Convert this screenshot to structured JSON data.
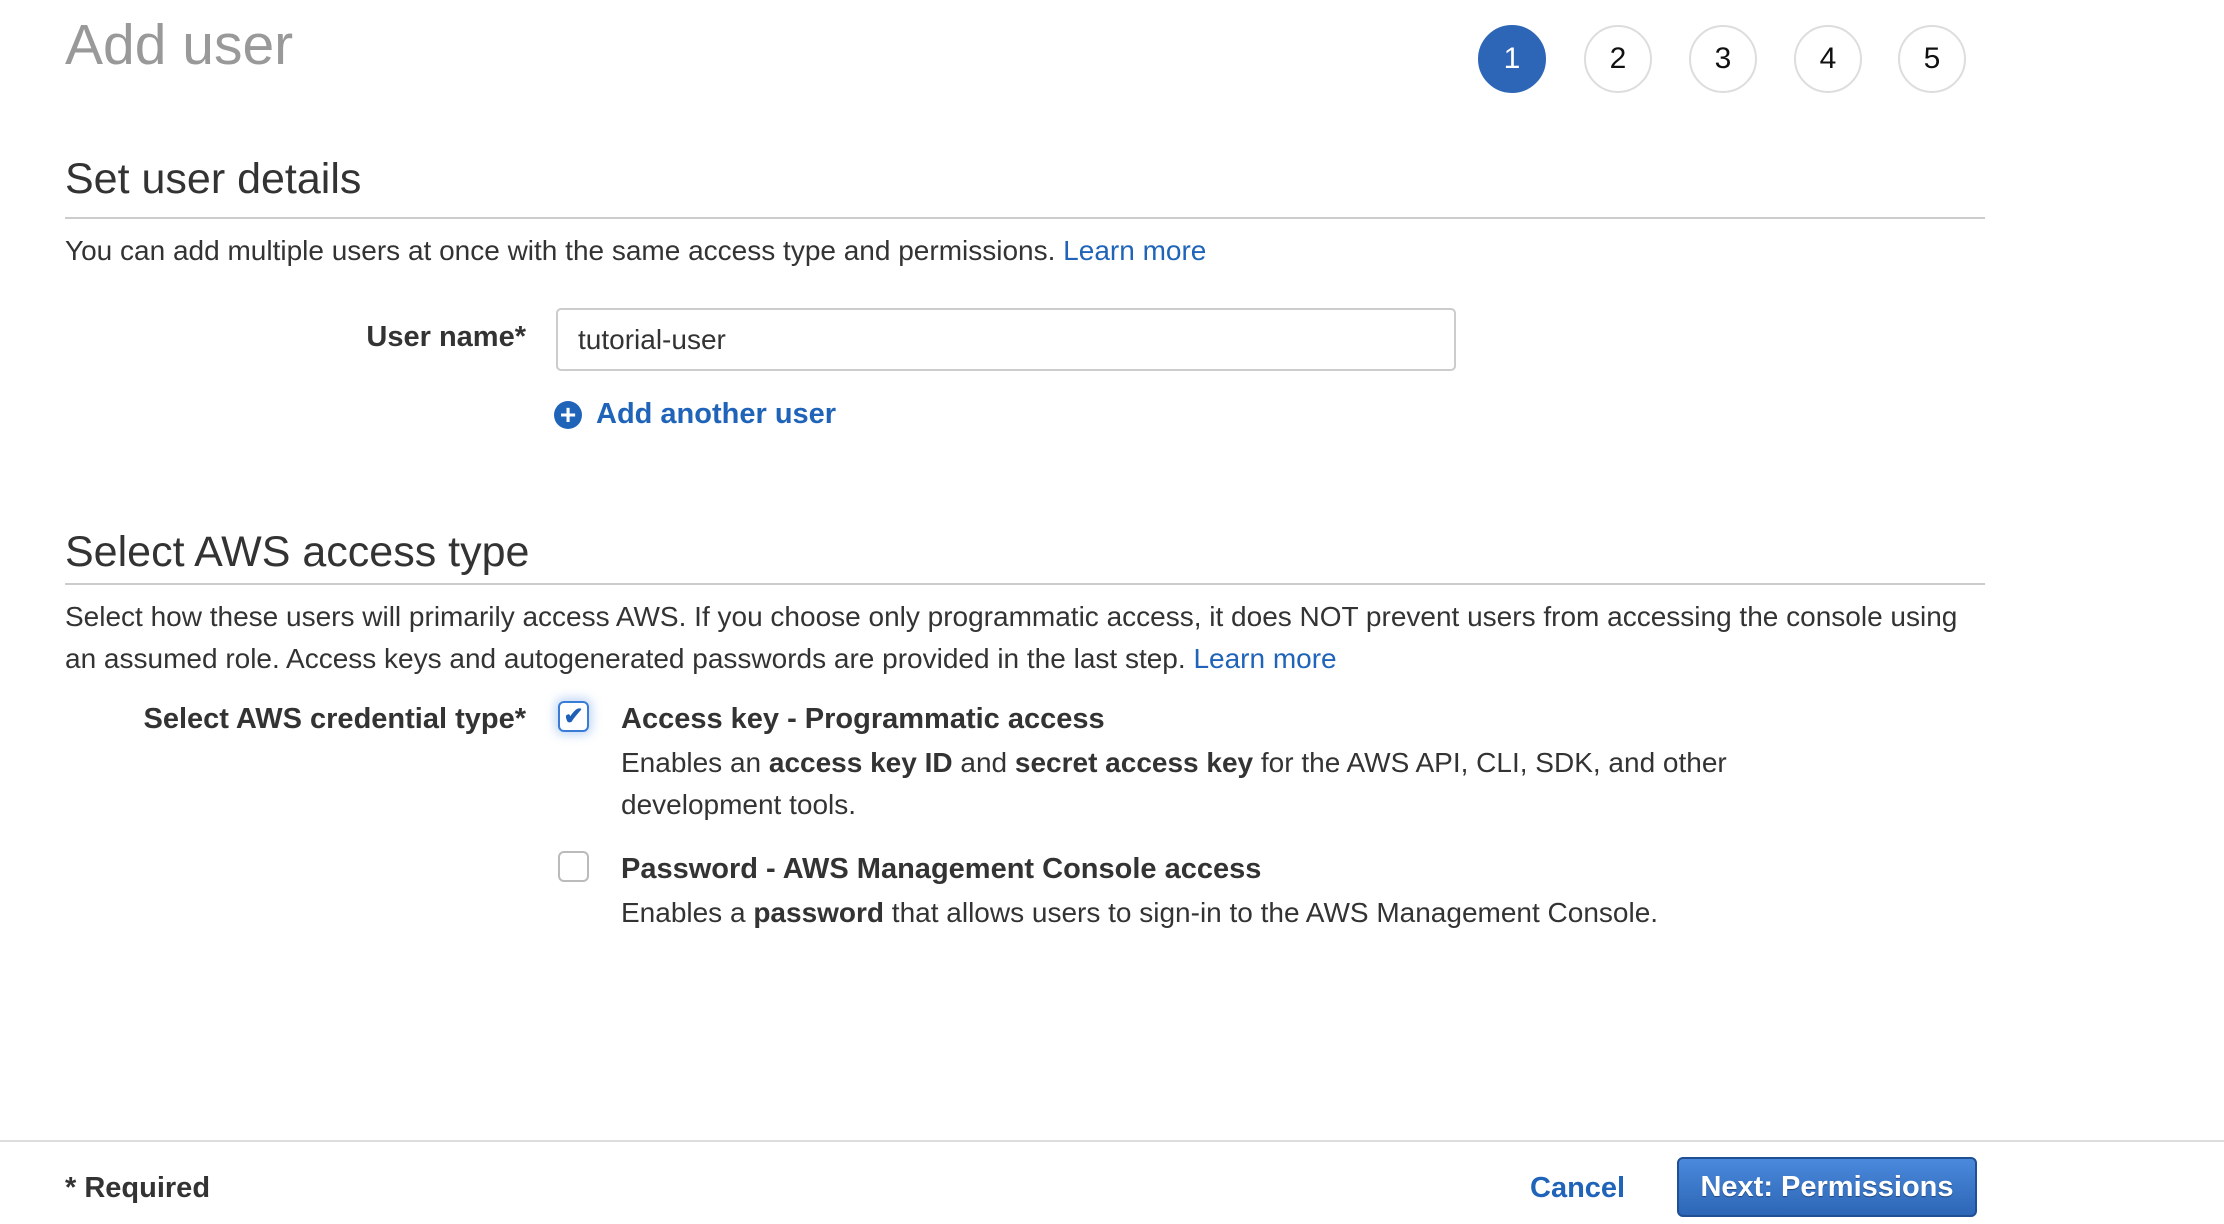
{
  "header": {
    "title": "Add user"
  },
  "steps": [
    {
      "label": "1",
      "active": true
    },
    {
      "label": "2",
      "active": false
    },
    {
      "label": "3",
      "active": false
    },
    {
      "label": "4",
      "active": false
    },
    {
      "label": "5",
      "active": false
    }
  ],
  "user_details": {
    "title": "Set user details",
    "description": "You can add multiple users at once with the same access type and permissions.",
    "learn_more": "Learn more",
    "username_label": "User name*",
    "username_value": "tutorial-user",
    "add_another": "Add another user"
  },
  "access_type": {
    "title": "Select AWS access type",
    "description": "Select how these users will primarily access AWS. If you choose only programmatic access, it does NOT prevent users from accessing the console using an assumed role. Access keys and autogenerated passwords are provided in the last step.",
    "learn_more": "Learn more",
    "credential_label": "Select AWS credential type*",
    "options": [
      {
        "title": "Access key - Programmatic access",
        "checked": true,
        "desc_parts": [
          "Enables an ",
          "access key ID",
          " and ",
          "secret access key",
          " for the AWS API, CLI, SDK, and other development tools."
        ]
      },
      {
        "title": "Password - AWS Management Console access",
        "checked": false,
        "desc_parts": [
          "Enables a ",
          "password",
          " that allows users to sign-in to the AWS Management Console."
        ]
      }
    ]
  },
  "footer": {
    "required": "* Required",
    "cancel": "Cancel",
    "next": "Next: Permissions"
  },
  "colors": {
    "accent": "#2d66b6",
    "link": "#1f64b8"
  }
}
